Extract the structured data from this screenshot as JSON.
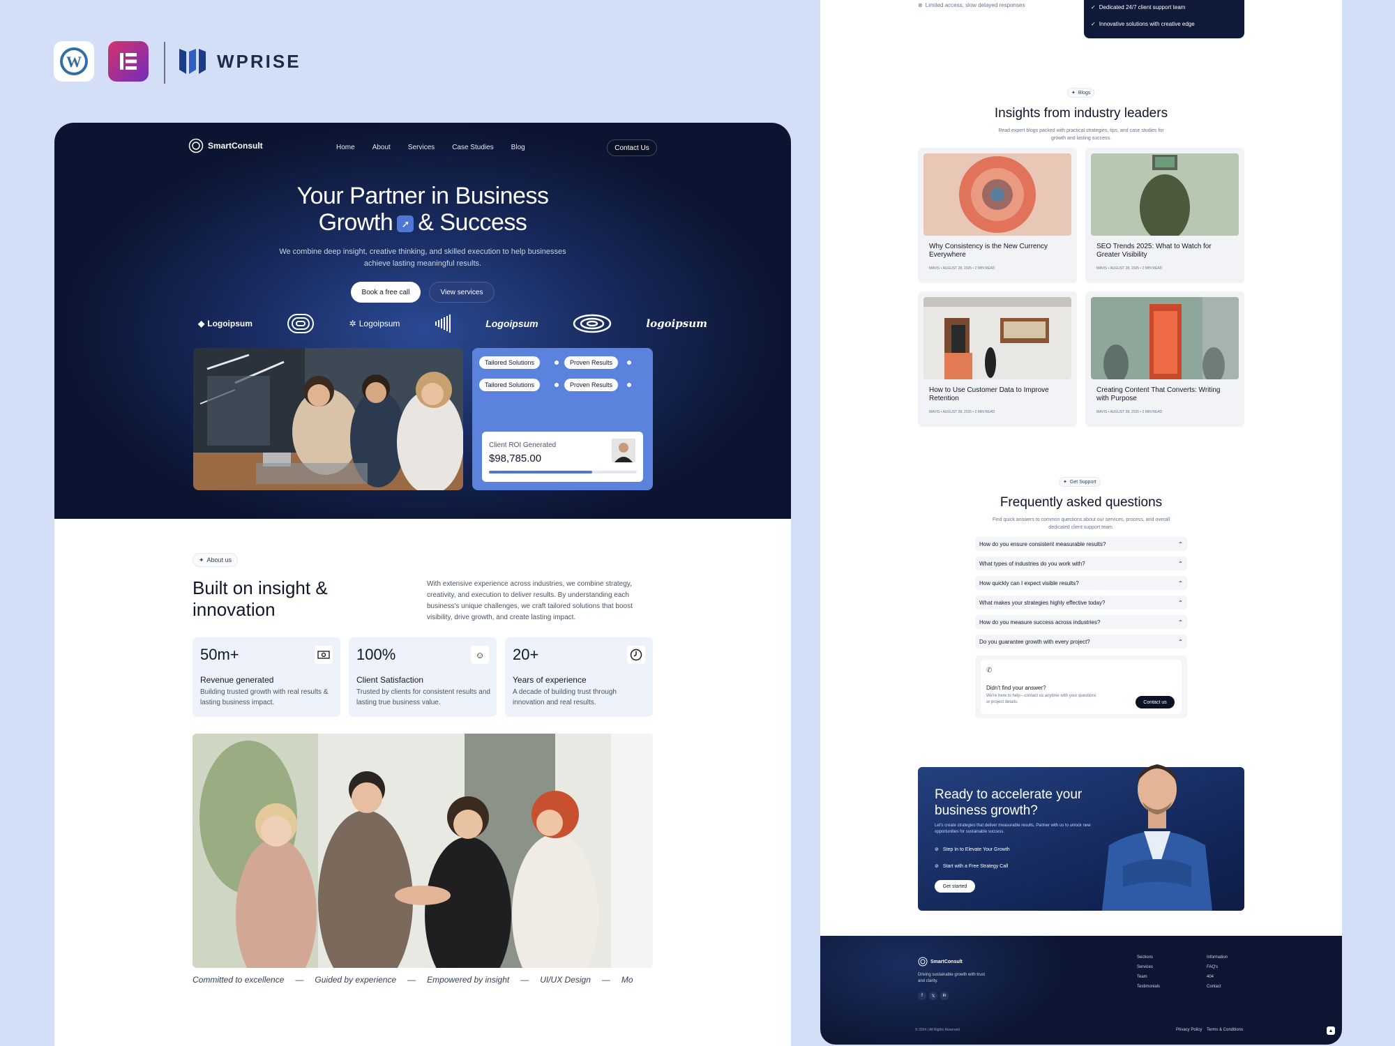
{
  "brand": {
    "wordmark": "WPRISE",
    "wp_icon": "wordpress-icon",
    "elementor_icon": "elementor-icon"
  },
  "hero": {
    "logo": "SmartConsult",
    "nav": [
      "Home",
      "About",
      "Services",
      "Case Studies",
      "Blog"
    ],
    "contact_label": "Contact Us",
    "title_line1": "Your Partner in Business",
    "title_line2a": "Growth",
    "title_line2b": "& Success",
    "subtitle": "We combine deep insight, creative thinking, and skilled execution to help businesses achieve lasting meaningful results.",
    "cta_primary": "Book a free call",
    "cta_secondary": "View services",
    "partner_logos": [
      "Logoipsum",
      "Logoipsum",
      "Logoipsum",
      "logoipsum"
    ],
    "pills": [
      "Tailored Solutions",
      "Proven Results",
      "Tailored Solutions",
      "Proven Results"
    ],
    "roi_label": "Client ROI Generated",
    "roi_value": "$98,785.00",
    "roi_progress": 0.7
  },
  "about": {
    "tag": "About us",
    "title": "Built on insight & innovation",
    "body": "With extensive experience across industries, we combine strategy, creativity, and execution to deliver results. By understanding each business's unique challenges, we craft tailored solutions that boost visibility, drive growth, and create lasting impact.",
    "stats": [
      {
        "value": "50m+",
        "title": "Revenue generated",
        "desc": "Building trusted growth with real results & lasting business impact.",
        "icon": "money-icon"
      },
      {
        "value": "100%",
        "title": "Client Satisfaction",
        "desc": "Trusted by clients for consistent results and lasting true business value.",
        "icon": "smile-icon"
      },
      {
        "value": "20+",
        "title": "Years of experience",
        "desc": "A decade of building trust through innovation and real results.",
        "icon": "clock-icon"
      }
    ],
    "ticker": [
      "Committed to excellence",
      "—",
      "Guided by experience",
      "—",
      "Empowered by insight",
      "—",
      "UI/UX Design",
      "—",
      "Mo"
    ]
  },
  "features_top": {
    "limited": "Limited access, slow delayed responses",
    "items": [
      "Dedicated 24/7 client support team",
      "Innovative solutions with creative edge"
    ]
  },
  "blogs": {
    "tag": "Blogs",
    "title": "Insights from industry leaders",
    "subtitle": "Read expert blogs packed with practical strategies, tips, and case studies for growth and lasting success.",
    "posts": [
      {
        "title": "Why Consistency is the New Currency Everywhere",
        "meta": "MAVIS • AUGUST 28, 2025 • 2 MIN READ"
      },
      {
        "title": "SEO Trends 2025: What to Watch for Greater Visibility",
        "meta": "MAVIS • AUGUST 28, 2025 • 2 MIN READ"
      },
      {
        "title": "How to Use Customer Data to Improve Retention",
        "meta": "MAVIS • AUGUST 28, 2025 • 2 MIN READ"
      },
      {
        "title": "Creating Content That Converts: Writing with Purpose",
        "meta": "MAVIS • AUGUST 28, 2025 • 2 MIN READ"
      }
    ]
  },
  "faq": {
    "tag": "Get Support",
    "title": "Frequently asked questions",
    "subtitle": "Find quick answers to common questions about our services, process, and overall dedicated client support team.",
    "questions": [
      "How do you ensure consistent measurable results?",
      "What types of industries do you work with?",
      "How quickly can I expect visible results?",
      "What makes your strategies highly effective today?",
      "How do you measure success across industries?",
      "Do you guarantee growth with every project?"
    ],
    "help_title": "Didn't find your answer?",
    "help_body": "We're here to help—contact us anytime with your questions or project details.",
    "help_btn": "Contact us"
  },
  "cta": {
    "title": "Ready to accelerate your business growth?",
    "subtitle": "Let's create strategies that deliver measurable results. Partner with us to unlock new opportunities for sustainable success.",
    "items": [
      "Step In to Elevate Your Growth",
      "Start with a Free Strategy Call"
    ],
    "button": "Get started"
  },
  "footer": {
    "logo": "SmartConsult",
    "tagline": "Driving sustainable growth with trust and clarity.",
    "col1_title": "Sections",
    "col1": [
      "Services",
      "Team",
      "Testimonials"
    ],
    "col2_title": "Information",
    "col2": [
      "FAQ's",
      "404",
      "Contact"
    ],
    "copyright": "© 2024 | All Rights Reserved",
    "legal": [
      "Privacy Policy",
      "Terms & Conditions"
    ]
  },
  "colors": {
    "accent": "#5b83de",
    "navy": "#0f1a3a",
    "page_bg": "#d3def7"
  }
}
